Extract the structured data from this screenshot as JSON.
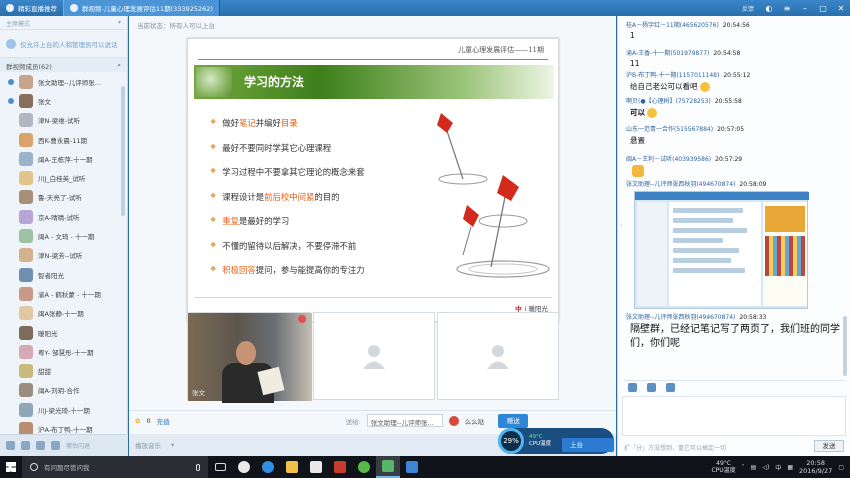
{
  "titlebar": {
    "tabs": [
      {
        "label": "精彩直播推荐"
      },
      {
        "label": "群视频-儿童心理发展评估11期(333925262)"
      }
    ],
    "right_link": "反馈"
  },
  "left_panel": {
    "mode_label": "主席模式",
    "notice": "仅允许上台的人和管理员可以说话",
    "list_header": "群视频成员(62)",
    "members": [
      {
        "name": "张文助理--儿评师张..."
      },
      {
        "name": "张文"
      },
      {
        "name": "津N-梁维-试听"
      },
      {
        "name": "西K-曹永晨-11期"
      },
      {
        "name": "闽A-王栋萍-十一期"
      },
      {
        "name": "川J_白桂英_试听"
      },
      {
        "name": "鲁-天亮了-试听"
      },
      {
        "name": "京A-晴晴-试听"
      },
      {
        "name": "闽A - 文琦 - 十一期"
      },
      {
        "name": "津N-梁芳--试听"
      },
      {
        "name": "智者阳光"
      },
      {
        "name": "渝A - 鹤秋蒙 - 十一期"
      },
      {
        "name": "闽A张静-十一期"
      },
      {
        "name": "暖阳光"
      },
      {
        "name": "粤Y- 邹慧彤-十一期"
      },
      {
        "name": "甜甜"
      },
      {
        "name": "闽A-刘玥-合作"
      },
      {
        "name": "川J-梁光琦-十一期"
      },
      {
        "name": "沪A-布丁鸭-十一期"
      }
    ],
    "bottom_label": "擦估闪退"
  },
  "center": {
    "top_status": "当前状态：所有人可以上台",
    "slide": {
      "header": "儿童心理发展评估——11期",
      "title": "学习的方法",
      "points": [
        {
          "before": "做好",
          "hl1": "笔记",
          "mid": "并编好",
          "hl2": "目录",
          "after": ""
        },
        {
          "before": "最好不要同时学其它心理课程",
          "hl1": "",
          "mid": "",
          "hl2": "",
          "after": ""
        },
        {
          "before": "学习过程中不要拿其它理论的概念来套",
          "hl1": "",
          "mid": "",
          "hl2": "",
          "after": ""
        },
        {
          "before": "课程设计是",
          "hl1": "前后校中间紧",
          "mid": "的目的",
          "hl2": "",
          "after": ""
        },
        {
          "before": "",
          "hl1": "重复",
          "mid": "是最好的学习",
          "hl2": "",
          "after": ""
        },
        {
          "before": "不懂的留待以后解决，不要停滞不前",
          "hl1": "",
          "mid": "",
          "hl2": "",
          "after": ""
        },
        {
          "before": "",
          "hl1": "积极回答",
          "mid": "提问，参与能提高你的专注力",
          "hl2": "",
          "after": ""
        }
      ],
      "logo_mark": "中",
      "logo_text": "i 暖阳光"
    },
    "video_main_name": "张文",
    "bar": {
      "flower_count": "0",
      "flower_label": "充值",
      "to_label": "送给:",
      "recipient": "张文助理--儿评师张...",
      "gift_name": "么么哒",
      "send_label": "赠送"
    },
    "status_bar": {
      "label": "播放音乐"
    }
  },
  "chat": {
    "messages": [
      {
        "sender": "桂A－杨宇红－11期",
        "qq": "(465620576)",
        "time": "20:54:56",
        "text": "1"
      },
      {
        "sender": "渝A-王香-十一期",
        "qq": "(501979877)",
        "time": "20:54:58",
        "text": "11"
      },
      {
        "sender": "沪B-布丁鸭-十一期",
        "qq": "(1157011148)",
        "time": "20:55:12",
        "text": "给自己老公可以看吧"
      },
      {
        "sender": "啊贝(●【心理树】",
        "qq": "(75728253)",
        "time": "20:55:58",
        "text": "可以"
      },
      {
        "sender": "山东一范青一合作",
        "qq": "(515567884)",
        "time": "20:57:05",
        "text": "悬置"
      },
      {
        "sender": "闽A－王利－试听",
        "qq": "(403939586)",
        "time": "20:57:29",
        "text": ""
      },
      {
        "sender": "张文助理--儿评师张西秋羽",
        "qq": "(494670874)",
        "time": "20:58:09",
        "text": ""
      },
      {
        "sender": "张文助理--儿评师张西秋羽",
        "qq": "(494670874)",
        "time": "20:58:33",
        "text": "隔壁群，已经记笔记写了两页了，我们班的同学们，你们呢"
      }
    ],
    "input_hint": "扩「分」方没想到，重它可以搞定一切",
    "send_label": "发送"
  },
  "float_widget": {
    "percent": "29%",
    "temp": "49°C",
    "temp_label": "CPU温度",
    "up_label": "上台"
  },
  "taskbar": {
    "search_placeholder": "有问题尽管问我",
    "temp": "49°C",
    "temp_label": "CPU温度",
    "ime": "中",
    "time": "20:58",
    "date": "2016/9/27"
  }
}
